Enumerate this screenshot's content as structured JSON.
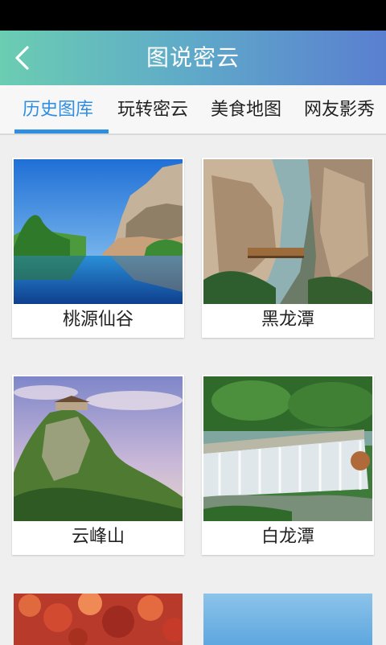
{
  "header": {
    "title": "图说密云",
    "back_icon": "chevron-left-icon"
  },
  "tabs": [
    {
      "label": "历史图库",
      "active": true
    },
    {
      "label": "玩转密云",
      "active": false
    },
    {
      "label": "美食地图",
      "active": false
    },
    {
      "label": "网友影秀",
      "active": false
    }
  ],
  "gallery": [
    {
      "label": "桃源仙谷"
    },
    {
      "label": "黑龙潭"
    },
    {
      "label": "云峰山"
    },
    {
      "label": "白龙潭"
    }
  ],
  "colors": {
    "header_gradient_start": "#6bcdb2",
    "header_gradient_end": "#5a7fd0",
    "active_tab": "#2f8ee0",
    "background": "#efefef"
  }
}
